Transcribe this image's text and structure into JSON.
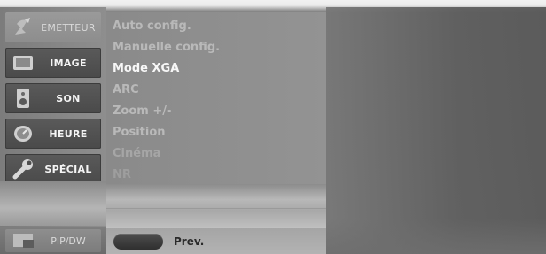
{
  "sidebar": {
    "items": [
      {
        "label": "EMETTEUR",
        "icon": "satellite-dish-icon",
        "state": "dim"
      },
      {
        "label": "IMAGE",
        "icon": "picture-icon",
        "state": "active"
      },
      {
        "label": "SON",
        "icon": "speaker-icon",
        "state": "active"
      },
      {
        "label": "HEURE",
        "icon": "clock-icon",
        "state": "active"
      },
      {
        "label": "SPÉCIAL",
        "icon": "wrench-icon",
        "state": "active"
      }
    ],
    "pip": {
      "label": "PIP/DW",
      "icon": "pip-icon"
    }
  },
  "submenu": {
    "items": [
      {
        "label": "Auto config.",
        "state": "normal"
      },
      {
        "label": "Manuelle config.",
        "state": "normal"
      },
      {
        "label": "Mode XGA",
        "state": "selected"
      },
      {
        "label": "ARC",
        "state": "normal"
      },
      {
        "label": "Zoom +/-",
        "state": "normal"
      },
      {
        "label": "Position",
        "state": "normal"
      },
      {
        "label": "Cinéma",
        "state": "faded"
      },
      {
        "label": "NR",
        "state": "fainter"
      }
    ]
  },
  "footer": {
    "prev_label": "Prev.",
    "prev_button_icon": "pill-button-icon"
  }
}
